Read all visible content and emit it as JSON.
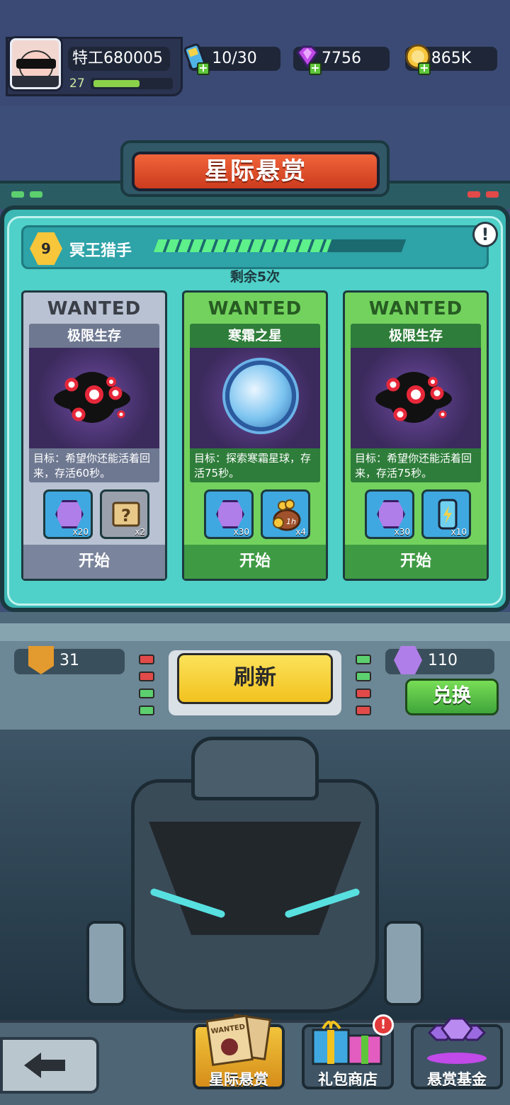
{
  "player": {
    "name": "特工680005",
    "level": "27",
    "xp_fraction": 0.6
  },
  "resources": {
    "energy": "10/30",
    "gems": "7756",
    "gold": "865K"
  },
  "title": "星际悬赏",
  "hunter": {
    "rank": "9",
    "title": "冥王猎手",
    "progress_fraction": 0.7
  },
  "remaining": "剩余5次",
  "cards": [
    {
      "style": "gray",
      "wanted": "WANTED",
      "name": "极限生存",
      "desc": "目标：希望你还能活着回来，存活60秒。",
      "rewards": [
        {
          "icon": "purple-hex-token-icon",
          "count": "x20"
        },
        {
          "icon": "mystery-scroll-icon",
          "count": "x2"
        }
      ],
      "button": "开始"
    },
    {
      "style": "green",
      "wanted": "WANTED",
      "name": "寒霜之星",
      "desc": "目标：探索寒霜星球，存活75秒。",
      "rewards": [
        {
          "icon": "purple-hex-token-icon",
          "count": "x30"
        },
        {
          "icon": "gold-bag-1h-icon",
          "count": "x4",
          "tag": "1h"
        }
      ],
      "button": "开始"
    },
    {
      "style": "green",
      "wanted": "WANTED",
      "name": "极限生存",
      "desc": "目标：希望你还能活着回来，存活75秒。",
      "rewards": [
        {
          "icon": "purple-hex-token-icon",
          "count": "x30"
        },
        {
          "icon": "energy-battery-icon",
          "count": "x10"
        }
      ],
      "button": "开始"
    }
  ],
  "console": {
    "badge_count": "31",
    "token_count": "110",
    "refresh_label": "刷新",
    "exchange_label": "兑换"
  },
  "nav": {
    "tab1": "星际悬赏",
    "tab2": "礼包商店",
    "tab3": "悬赏基金",
    "scroll_art_text": "WANTED",
    "alert": "!"
  },
  "info_icon_text": "!",
  "colors": {
    "title_banner": "#e9542f",
    "panel": "#4fd0c8",
    "card_green": "#72d25d",
    "card_gray": "#b8c2d2",
    "refresh": "#f7d33a",
    "exchange": "#5ec63b"
  }
}
